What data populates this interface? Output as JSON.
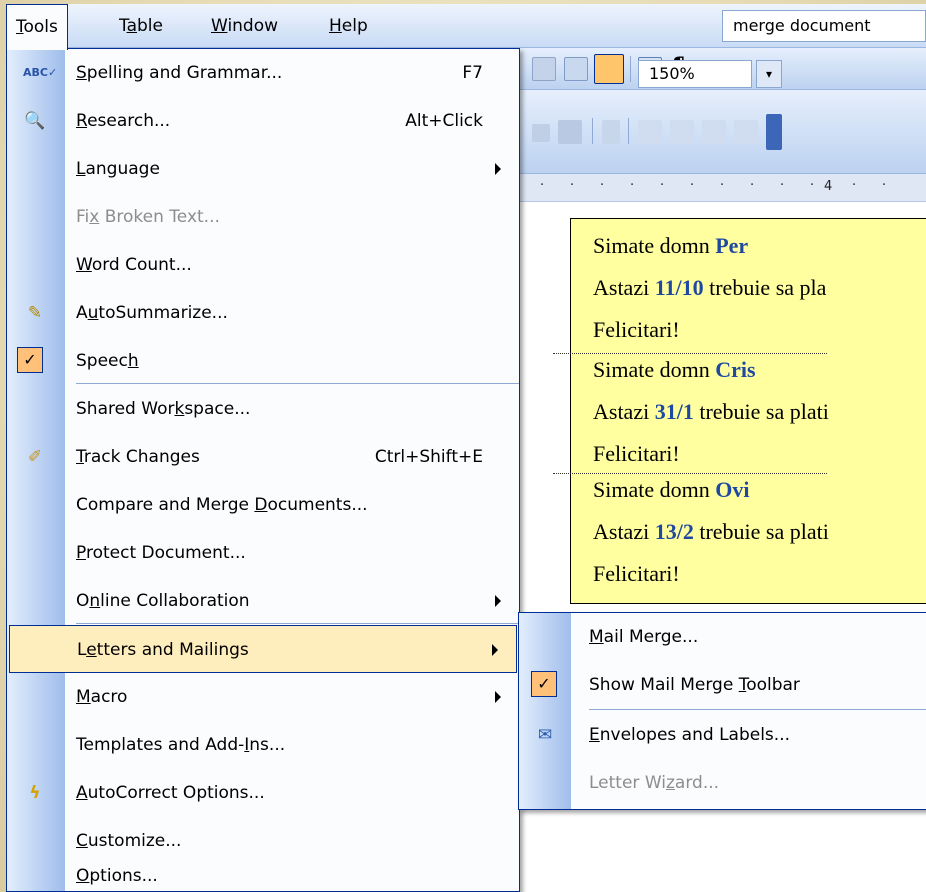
{
  "menubar": {
    "items": [
      {
        "pre": "",
        "u": "T",
        "post": "ools"
      },
      {
        "pre": "T",
        "u": "a",
        "post": "ble"
      },
      {
        "pre": "",
        "u": "W",
        "post": "indow"
      },
      {
        "pre": "",
        "u": "H",
        "post": "elp"
      }
    ],
    "search_value": "merge document"
  },
  "toolbar": {
    "zoom": "150%",
    "paragraph_mark": "¶",
    "dropdown_arrow": "▾",
    "ruler_mark": "4"
  },
  "tools_menu": {
    "items": [
      {
        "pre": "",
        "u": "S",
        "post": "pelling and Grammar...",
        "shortcut": "F7",
        "icon": "spelling-icon"
      },
      {
        "pre": "",
        "u": "R",
        "post": "esearch...",
        "shortcut": "Alt+Click",
        "icon": "research-icon"
      },
      {
        "pre": "",
        "u": "L",
        "post": "anguage",
        "submenu": true
      },
      {
        "pre": "Fi",
        "u": "x",
        "post": " Broken Text...",
        "disabled": true
      },
      {
        "pre": "",
        "u": "W",
        "post": "ord Count..."
      },
      {
        "pre": "A",
        "u": "u",
        "post": "toSummarize...",
        "icon": "autosummarize-icon"
      },
      {
        "pre": "Speec",
        "u": "h",
        "post": "",
        "checked": true
      },
      {
        "pre": "Shared Wor",
        "u": "k",
        "post": "space..."
      },
      {
        "pre": "",
        "u": "T",
        "post": "rack Changes",
        "shortcut": "Ctrl+Shift+E",
        "icon": "track-changes-icon"
      },
      {
        "pre": "Compare and Merge ",
        "u": "D",
        "post": "ocuments..."
      },
      {
        "pre": "",
        "u": "P",
        "post": "rotect Document..."
      },
      {
        "pre": "O",
        "u": "n",
        "post": "line Collaboration",
        "submenu": true
      },
      {
        "pre": "L",
        "u": "e",
        "post": "tters and Mailings",
        "submenu": true,
        "highlight": true
      },
      {
        "pre": "",
        "u": "M",
        "post": "acro",
        "submenu": true
      },
      {
        "pre": "Templates and Add-",
        "u": "I",
        "post": "ns..."
      },
      {
        "pre": "",
        "u": "A",
        "post": "utoCorrect Options...",
        "icon": "autocorrect-icon"
      },
      {
        "pre": "",
        "u": "C",
        "post": "ustomize..."
      },
      {
        "pre": "",
        "u": "O",
        "post": "ptions..."
      }
    ]
  },
  "letters_submenu": {
    "items": [
      {
        "pre": "",
        "u": "M",
        "post": "ail Merge..."
      },
      {
        "pre": "Show Mail Merge ",
        "u": "T",
        "post": "oolbar",
        "checked": true
      },
      {
        "pre": "",
        "u": "E",
        "post": "nvelopes and Labels...",
        "icon": "envelope-icon"
      },
      {
        "pre": "Letter Wi",
        "u": "z",
        "post": "ard...",
        "disabled": true
      }
    ]
  },
  "document": {
    "records": [
      {
        "greeting": "Simate domn ",
        "name": "Per",
        "line2_pre": "Astazi ",
        "date": "11/10",
        "line2_post": " trebuie sa pla",
        "closing": "Felicitari!"
      },
      {
        "greeting": "Simate domn ",
        "name": "Cris",
        "line2_pre": "Astazi ",
        "date": "31/1",
        "line2_post": " trebuie sa plati",
        "closing": "Felicitari!"
      },
      {
        "greeting": "Simate domn ",
        "name": "Ovi",
        "line2_pre": "Astazi ",
        "date": "13/2",
        "line2_post": " trebuie sa plati",
        "closing": "Felicitari!"
      }
    ]
  },
  "colors": {
    "menu_border": "#002d96",
    "highlight": "#ffeebd",
    "merge_field": "#1f49a0",
    "doc_background": "#ffff9f"
  }
}
